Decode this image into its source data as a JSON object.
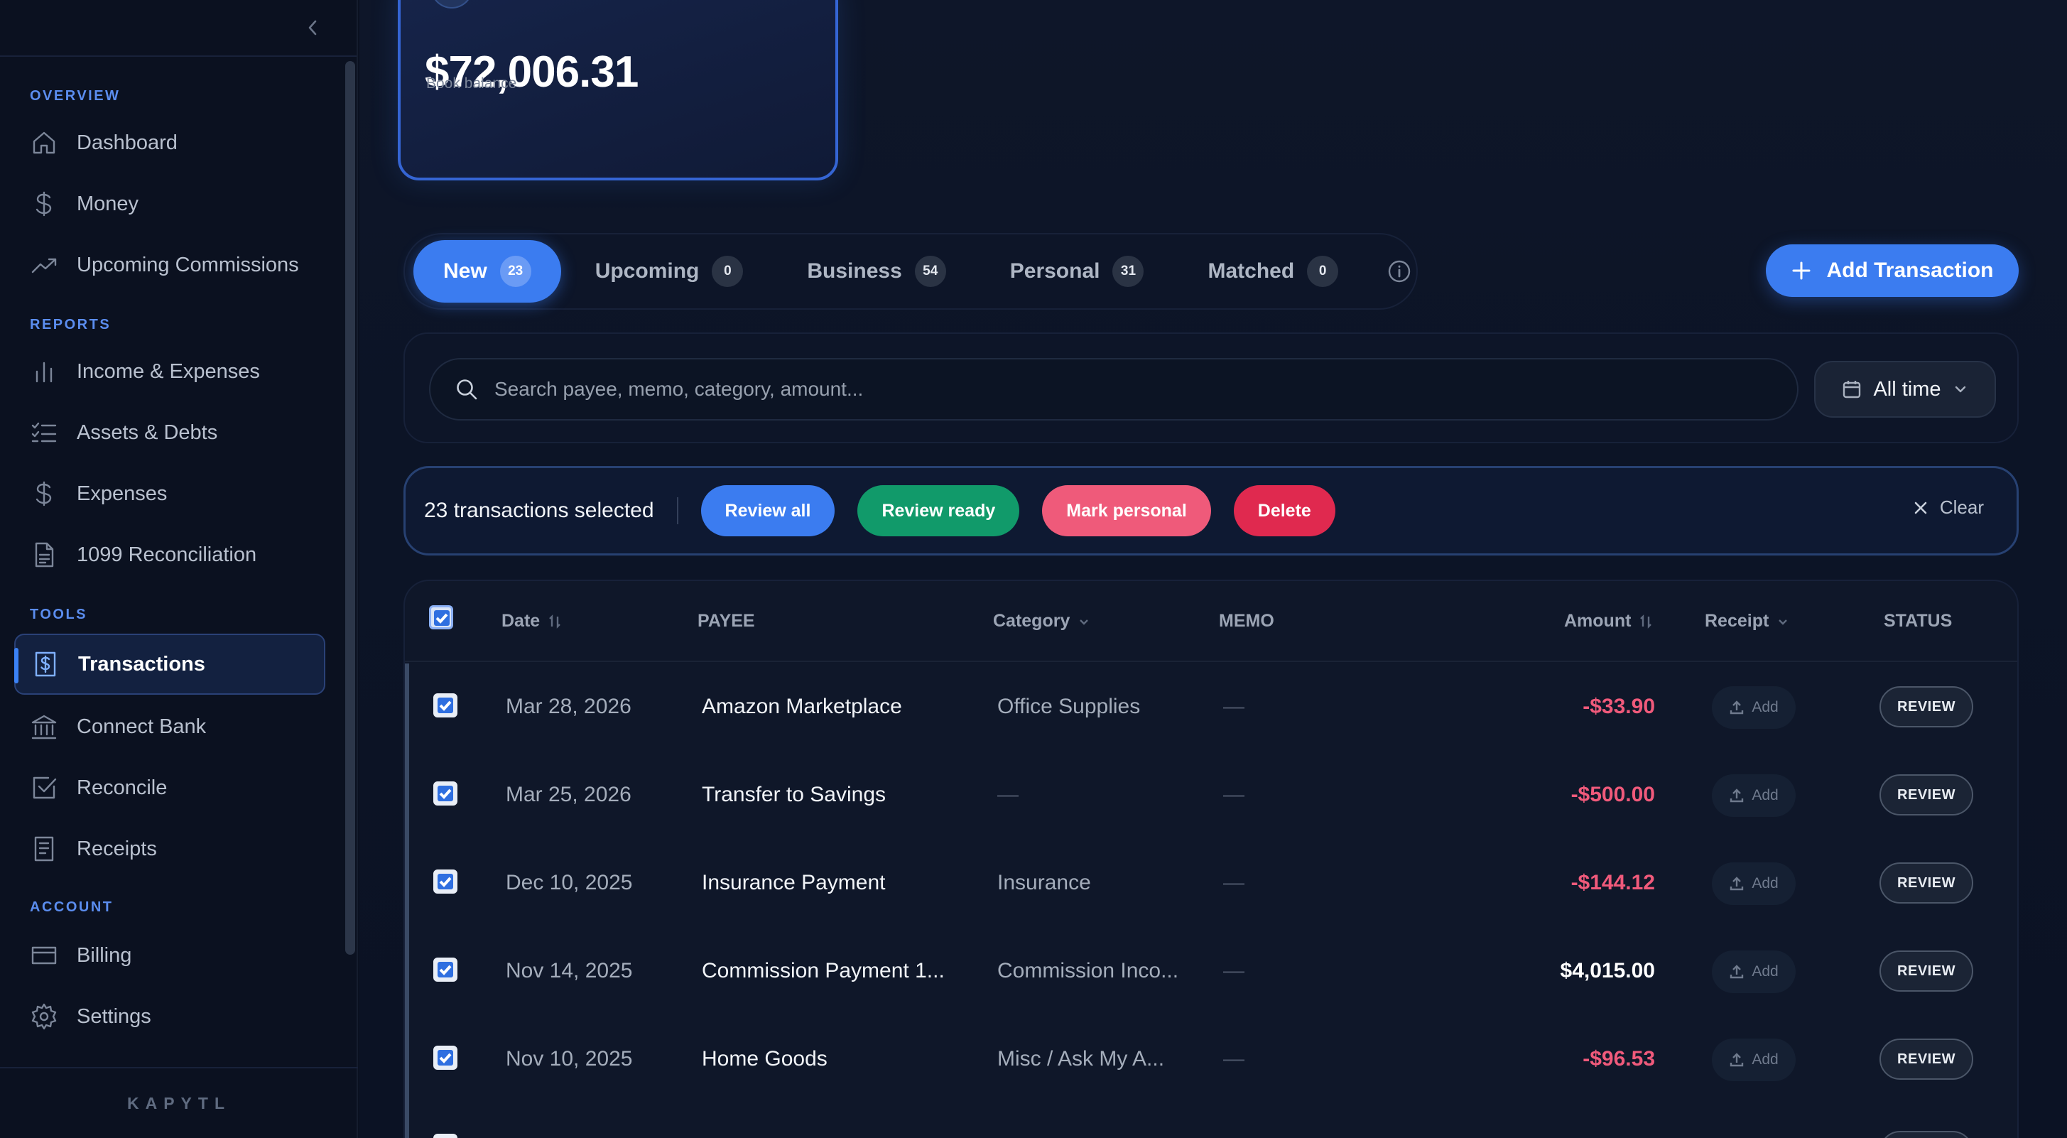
{
  "sidebar": {
    "sections": [
      {
        "label": "OVERVIEW",
        "items": [
          {
            "label": "Dashboard",
            "icon": "home-icon"
          },
          {
            "label": "Money",
            "icon": "dollar-icon"
          },
          {
            "label": "Upcoming Commissions",
            "icon": "trending-up-icon"
          }
        ]
      },
      {
        "label": "REPORTS",
        "items": [
          {
            "label": "Income & Expenses",
            "icon": "bar-chart-icon"
          },
          {
            "label": "Assets & Debts",
            "icon": "checklist-icon"
          },
          {
            "label": "Expenses",
            "icon": "dollar-icon"
          },
          {
            "label": "1099 Reconciliation",
            "icon": "document-icon"
          }
        ]
      },
      {
        "label": "TOOLS",
        "items": [
          {
            "label": "Transactions",
            "icon": "receipt-dollar-icon",
            "active": true
          },
          {
            "label": "Connect Bank",
            "icon": "bank-icon"
          },
          {
            "label": "Reconcile",
            "icon": "check-square-icon"
          },
          {
            "label": "Receipts",
            "icon": "receipt-icon"
          }
        ]
      },
      {
        "label": "ACCOUNT",
        "items": [
          {
            "label": "Billing",
            "icon": "credit-card-icon"
          },
          {
            "label": "Settings",
            "icon": "gear-icon"
          }
        ]
      }
    ],
    "brand": "KAPYTL"
  },
  "balance_card": {
    "amount": "$72,006.31",
    "label": "Book balance"
  },
  "tabs": [
    {
      "label": "New",
      "count": "23",
      "active": true
    },
    {
      "label": "Upcoming",
      "count": "0"
    },
    {
      "label": "Business",
      "count": "54"
    },
    {
      "label": "Personal",
      "count": "31"
    },
    {
      "label": "Matched",
      "count": "0"
    }
  ],
  "add_button_label": "Add Transaction",
  "search": {
    "placeholder": "Search payee, memo, category, amount...",
    "date_filter": "All time"
  },
  "bulk": {
    "selected_text": "23 transactions selected",
    "review_all": "Review all",
    "review_ready": "Review ready",
    "mark_personal": "Mark personal",
    "delete": "Delete",
    "clear": "Clear"
  },
  "table": {
    "columns": {
      "date": "Date",
      "payee": "PAYEE",
      "category": "Category",
      "memo": "MEMO",
      "amount": "Amount",
      "receipt": "Receipt",
      "status": "STATUS"
    },
    "rows": [
      {
        "date": "Mar 28, 2026",
        "payee": "Amazon Marketplace",
        "category": "Office Supplies",
        "memo": "—",
        "amount": "-$33.90",
        "negative": true,
        "receipt": "Add",
        "status": "REVIEW",
        "checked": true
      },
      {
        "date": "Mar 25, 2026",
        "payee": "Transfer to Savings",
        "category": "—",
        "memo": "—",
        "amount": "-$500.00",
        "negative": true,
        "receipt": "Add",
        "status": "REVIEW",
        "checked": true
      },
      {
        "date": "Dec 10, 2025",
        "payee": "Insurance Payment",
        "category": "Insurance",
        "memo": "—",
        "amount": "-$144.12",
        "negative": true,
        "receipt": "Add",
        "status": "REVIEW",
        "checked": true
      },
      {
        "date": "Nov 14, 2025",
        "payee": "Commission Payment 1...",
        "category": "Commission Inco...",
        "memo": "—",
        "amount": "$4,015.00",
        "negative": false,
        "receipt": "Add",
        "status": "REVIEW",
        "checked": true
      },
      {
        "date": "Nov 10, 2025",
        "payee": "Home Goods",
        "category": "Misc / Ask My A...",
        "memo": "—",
        "amount": "-$96.53",
        "negative": true,
        "receipt": "Add",
        "status": "REVIEW",
        "checked": true
      }
    ]
  },
  "colors": {
    "accent": "#3b7cf0",
    "negative": "#f05a7b",
    "success": "#119a6a",
    "danger": "#e0294f",
    "background": "#0b1120"
  }
}
